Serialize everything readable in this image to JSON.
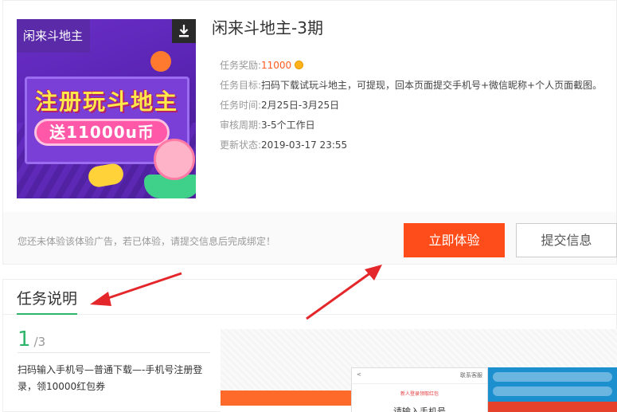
{
  "banner": {
    "tag": "闲来斗地主",
    "headline": "注册玩斗地主",
    "promo": "送11000u币",
    "download_icon": "download-icon"
  },
  "task": {
    "title": "闲来斗地主-3期",
    "fields": [
      {
        "key": "任务奖励:",
        "value": "11000"
      },
      {
        "key": "任务目标:",
        "value": "扫码下载试玩斗地主，可提现，回本页面提交手机号+微信昵称+个人页面截图。"
      },
      {
        "key": "任务时间:",
        "value": "2月25日-3月25日"
      },
      {
        "key": "审核周期:",
        "value": "3-5个工作日"
      },
      {
        "key": "更新状态:",
        "value": "2019-03-17 23:55"
      }
    ]
  },
  "actions": {
    "notice": "您还未体验该体验广告，若已体验，请提交信息后完成绑定！",
    "primary": "立即体验",
    "secondary": "提交信息"
  },
  "section": {
    "title": "任务说明",
    "step_current": "1",
    "step_total": "/3",
    "step_text": "扫码输入手机号—普通下载—-手机号注册登录，领10000红包券"
  },
  "screenshot": {
    "back": "<",
    "service": "联系客服",
    "red_note": "新人登录领取红包",
    "input_hint": "请输入手机号"
  },
  "colors": {
    "accent": "#fe4d1a",
    "reward": "#ff5a1f",
    "section_underline": "#2fb56b",
    "arrow": "#e4272b"
  }
}
